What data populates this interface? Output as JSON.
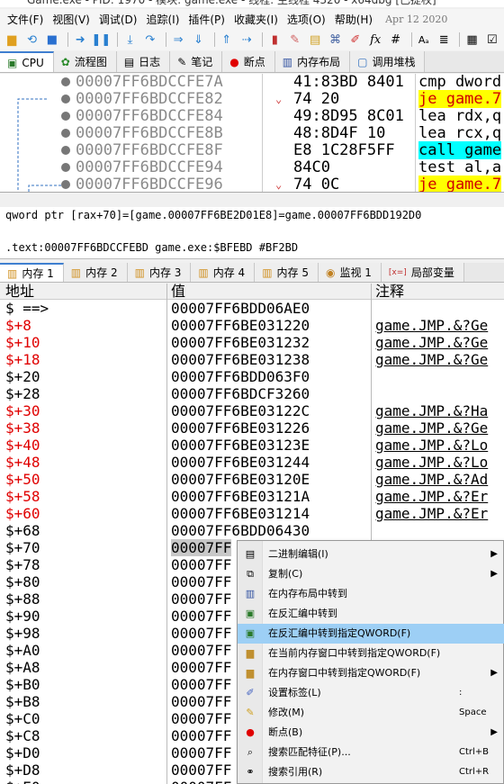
{
  "titlebar": {
    "text": "Game.exe - PID: 1970 - 模块: game.exe - 线程: 主线程 4320 - x64dbg [已提权]"
  },
  "menu": {
    "items": [
      "文件(F)",
      "视图(V)",
      "调试(D)",
      "追踪(I)",
      "插件(P)",
      "收藏夹(I)",
      "选项(O)",
      "帮助(H)"
    ],
    "date": "Apr 12 2020"
  },
  "main_tabs": [
    {
      "label": "CPU",
      "icon": "cpu-icon"
    },
    {
      "label": "流程图",
      "icon": "graph-icon"
    },
    {
      "label": "日志",
      "icon": "log-icon"
    },
    {
      "label": "笔记",
      "icon": "notes-icon"
    },
    {
      "label": "断点",
      "icon": "breakpoint-icon"
    },
    {
      "label": "内存布局",
      "icon": "memory-map-icon"
    },
    {
      "label": "调用堆栈",
      "icon": "call-stack-icon"
    }
  ],
  "cpu": {
    "rows": [
      {
        "addr": "00007FF6BDCCFE7A",
        "bytes": "41:83BD 8401",
        "instr": "cmp dword",
        "hl": "",
        "arrow": ""
      },
      {
        "addr": "00007FF6BDCCFE82",
        "bytes": "74 20",
        "instr": "je game.7",
        "hl": "yellow",
        "arrow": "⌄"
      },
      {
        "addr": "00007FF6BDCCFE84",
        "bytes": "49:8D95 8C01",
        "instr": "lea rdx,q",
        "hl": "",
        "arrow": ""
      },
      {
        "addr": "00007FF6BDCCFE8B",
        "bytes": "48:8D4F 10",
        "instr": "lea rcx,q",
        "hl": "",
        "arrow": ""
      },
      {
        "addr": "00007FF6BDCCFE8F",
        "bytes": "E8 1C28F5FF",
        "instr": "call game",
        "hl": "cyan",
        "arrow": ""
      },
      {
        "addr": "00007FF6BDCCFE94",
        "bytes": "84C0",
        "instr": "test al,a",
        "hl": "",
        "arrow": ""
      },
      {
        "addr": "00007FF6BDCCFE96",
        "bytes": "74 0C",
        "instr": "je game.7",
        "hl": "yellow",
        "arrow": "⌄"
      }
    ]
  },
  "info": {
    "line1": "qword ptr [rax+70]=[game.00007FF6BE2D01E8]=game.00007FF6BDD192D0",
    "line2": ".text:00007FF6BDCCFEBD game.exe:$BFEBD #BF2BD"
  },
  "dump_tabs": [
    {
      "label": "内存 1"
    },
    {
      "label": "内存 2"
    },
    {
      "label": "内存 3"
    },
    {
      "label": "内存 4"
    },
    {
      "label": "内存 5"
    },
    {
      "label": "监视 1"
    },
    {
      "label": "局部变量"
    }
  ],
  "dump": {
    "headers": {
      "addr": "地址",
      "value": "值",
      "comment": "注释"
    },
    "rows": [
      {
        "addr": "$ ==>",
        "value": "00007FF6BDD06AE0",
        "comment": "",
        "red": false
      },
      {
        "addr": "$+8",
        "value": "00007FF6BE031220",
        "comment": "game.JMP.&?Ge",
        "red": true
      },
      {
        "addr": "$+10",
        "value": "00007FF6BE031232",
        "comment": "game.JMP.&?Ge",
        "red": true
      },
      {
        "addr": "$+18",
        "value": "00007FF6BE031238",
        "comment": "game.JMP.&?Ge",
        "red": true
      },
      {
        "addr": "$+20",
        "value": "00007FF6BDD063F0",
        "comment": "",
        "red": false
      },
      {
        "addr": "$+28",
        "value": "00007FF6BDCF3260",
        "comment": "",
        "red": false
      },
      {
        "addr": "$+30",
        "value": "00007FF6BE03122C",
        "comment": "game.JMP.&?Ha",
        "red": true
      },
      {
        "addr": "$+38",
        "value": "00007FF6BE031226",
        "comment": "game.JMP.&?Ge",
        "red": true
      },
      {
        "addr": "$+40",
        "value": "00007FF6BE03123E",
        "comment": "game.JMP.&?Lo",
        "red": true
      },
      {
        "addr": "$+48",
        "value": "00007FF6BE031244",
        "comment": "game.JMP.&?Lo",
        "red": true
      },
      {
        "addr": "$+50",
        "value": "00007FF6BE03120E",
        "comment": "game.JMP.&?Ad",
        "red": true
      },
      {
        "addr": "$+58",
        "value": "00007FF6BE03121A",
        "comment": "game.JMP.&?Er",
        "red": true
      },
      {
        "addr": "$+60",
        "value": "00007FF6BE031214",
        "comment": "game.JMP.&?Er",
        "red": true
      },
      {
        "addr": "$+68",
        "value": "00007FF6BDD06430",
        "comment": "",
        "red": false
      },
      {
        "addr": "$+70",
        "value": "00007FF",
        "comment": "",
        "red": false,
        "selected": true
      },
      {
        "addr": "$+78",
        "value": "00007FF",
        "comment": "",
        "red": false
      },
      {
        "addr": "$+80",
        "value": "00007FF",
        "comment": "",
        "red": false
      },
      {
        "addr": "$+88",
        "value": "00007FF",
        "comment": "",
        "red": false
      },
      {
        "addr": "$+90",
        "value": "00007FF",
        "comment": "",
        "red": false
      },
      {
        "addr": "$+98",
        "value": "00007FF",
        "comment": "",
        "red": false
      },
      {
        "addr": "$+A0",
        "value": "00007FF",
        "comment": "",
        "red": false
      },
      {
        "addr": "$+A8",
        "value": "00007FF",
        "comment": "",
        "red": false
      },
      {
        "addr": "$+B0",
        "value": "00007FF",
        "comment": "",
        "red": false
      },
      {
        "addr": "$+B8",
        "value": "00007FF",
        "comment": "",
        "red": false
      },
      {
        "addr": "$+C0",
        "value": "00007FF",
        "comment": "",
        "red": false
      },
      {
        "addr": "$+C8",
        "value": "00007FF",
        "comment": "",
        "red": false
      },
      {
        "addr": "$+D0",
        "value": "00007FF",
        "comment": "",
        "red": false
      },
      {
        "addr": "$+D8",
        "value": "00007FF",
        "comment": "",
        "red": false
      },
      {
        "addr": "$+E0",
        "value": "00007FF",
        "comment": "",
        "red": false
      }
    ]
  },
  "context_menu": {
    "items": [
      {
        "label": "二进制编辑(I)",
        "shortcut": "",
        "submenu": true,
        "icon": "binary-edit-icon"
      },
      {
        "label": "复制(C)",
        "shortcut": "",
        "submenu": true,
        "icon": "copy-icon"
      },
      {
        "label": "在内存布局中转到",
        "shortcut": "",
        "submenu": false,
        "icon": "memory-map-icon"
      },
      {
        "label": "在反汇编中转到",
        "shortcut": "",
        "submenu": false,
        "icon": "disasm-icon"
      },
      {
        "label": "在反汇编中转到指定QWORD(F)",
        "shortcut": "",
        "submenu": false,
        "icon": "disasm-qword-icon",
        "hover": true
      },
      {
        "label": "在当前内存窗口中转到指定QWORD(F)",
        "shortcut": "",
        "submenu": false,
        "icon": "dump-qword-icon"
      },
      {
        "label": "在内存窗口中转到指定QWORD(F)",
        "shortcut": "",
        "submenu": true,
        "icon": "dump-window-icon"
      },
      {
        "label": "设置标签(L)",
        "shortcut": ":",
        "submenu": false,
        "icon": "label-icon"
      },
      {
        "label": "修改(M)",
        "shortcut": "Space",
        "submenu": false,
        "icon": "modify-icon"
      },
      {
        "label": "断点(B)",
        "shortcut": "",
        "submenu": true,
        "icon": "breakpoint-icon"
      },
      {
        "label": "搜索匹配特征(P)...",
        "shortcut": "Ctrl+B",
        "submenu": false,
        "icon": "search-pattern-icon"
      },
      {
        "label": "搜索引用(R)",
        "shortcut": "Ctrl+R",
        "submenu": false,
        "icon": "binoculars-icon"
      }
    ]
  }
}
